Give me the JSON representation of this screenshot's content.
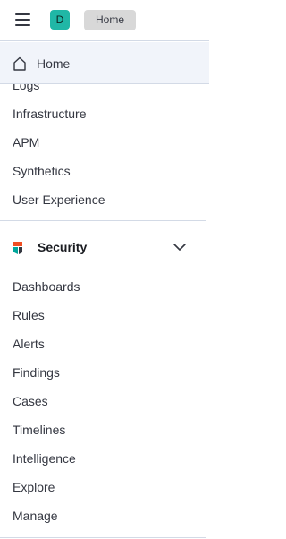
{
  "header": {
    "avatar_initial": "D",
    "breadcrumb": "Home"
  },
  "home": {
    "label": "Home"
  },
  "observability": {
    "items": [
      "Logs",
      "Infrastructure",
      "APM",
      "Synthetics",
      "User Experience"
    ]
  },
  "security": {
    "title": "Security",
    "items": [
      "Dashboards",
      "Rules",
      "Alerts",
      "Findings",
      "Cases",
      "Timelines",
      "Intelligence",
      "Explore",
      "Manage"
    ]
  },
  "colors": {
    "accent": "#20b7a6",
    "security_logo_orange": "#f04e23",
    "security_logo_teal": "#00a69b",
    "security_logo_dark": "#343741"
  },
  "icons": {
    "menu": "hamburger-icon",
    "home": "home-icon",
    "security": "security-logo-icon",
    "collapse": "chevron-down-icon"
  }
}
